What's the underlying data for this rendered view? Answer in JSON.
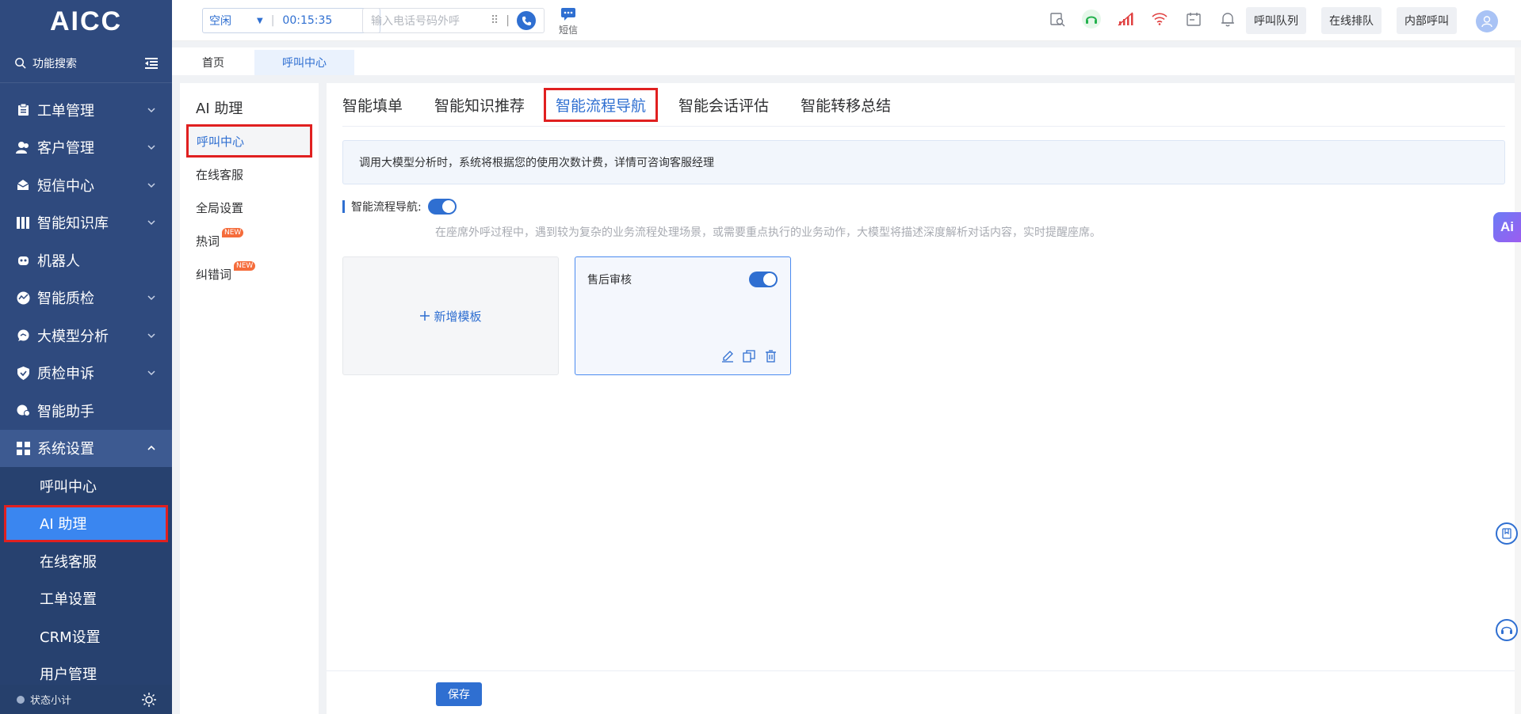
{
  "app": {
    "logo": "AICC"
  },
  "sidebar": {
    "search_label": "功能搜索",
    "menu_items": [
      {
        "label": "工单管理",
        "icon": "clipboard-icon"
      },
      {
        "label": "客户管理",
        "icon": "users-icon"
      },
      {
        "label": "短信中心",
        "icon": "mail-icon"
      },
      {
        "label": "智能知识库",
        "icon": "library-icon"
      },
      {
        "label": "机器人",
        "icon": "robot-icon"
      },
      {
        "label": "智能质检",
        "icon": "chart-icon"
      },
      {
        "label": "大模型分析",
        "icon": "chat-icon"
      },
      {
        "label": "质检申诉",
        "icon": "shield-icon"
      },
      {
        "label": "智能助手",
        "icon": "assistant-icon"
      },
      {
        "label": "系统设置",
        "icon": "grid-icon"
      }
    ],
    "sub_items": [
      "呼叫中心",
      "AI 助理",
      "在线客服",
      "工单设置",
      "CRM设置",
      "用户管理"
    ],
    "bottom_label": "状态小计"
  },
  "topbar": {
    "status": "空闲",
    "timer": "00:15:35",
    "dial_placeholder": "输入电话号码外呼",
    "sms_label": "短信",
    "btn_queue": "呼叫队列",
    "btn_online_queue": "在线排队",
    "btn_internal_call": "内部呼叫"
  },
  "pagetabs": [
    "首页",
    "呼叫中心"
  ],
  "subpanel": {
    "title": "AI 助理",
    "items": [
      "呼叫中心",
      "在线客服",
      "全局设置",
      "热词",
      "纠错词"
    ],
    "badge": "NEW"
  },
  "content": {
    "tabs": [
      "智能填单",
      "智能知识推荐",
      "智能流程导航",
      "智能会话评估",
      "智能转移总结"
    ],
    "notice": "调用大模型分析时，系统将根据您的使用次数计费，详情可咨询客服经理",
    "feature_label": "智能流程导航:",
    "feature_desc": "在座席外呼过程中，遇到较为复杂的业务流程处理场景，或需要重点执行的业务动作，大模型将描述深度解析对话内容，实时提醒座席。",
    "add_template": "新增模板",
    "template_name": "售后审核",
    "save": "保存"
  },
  "float": {
    "ai_label": "Ai"
  },
  "colors": {
    "primary": "#2f6fd1",
    "sidebar": "#2f4a7e",
    "highlight": "#e02020"
  }
}
